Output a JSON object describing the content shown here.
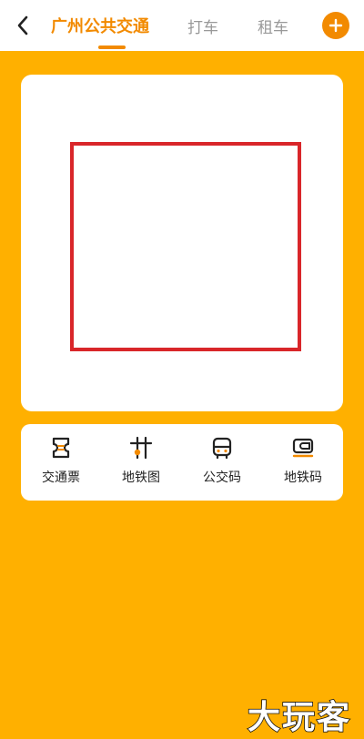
{
  "colors": {
    "background": "#FFB000",
    "accent": "#F28A00",
    "qr_frame": "#D9262A",
    "tab_inactive": "#999999"
  },
  "header": {
    "back_icon": "chevron-left-icon",
    "tabs": [
      {
        "label": "广州公共交通",
        "active": true
      },
      {
        "label": "打车",
        "active": false
      },
      {
        "label": "租车",
        "active": false
      }
    ],
    "add_icon": "plus-circle-icon"
  },
  "qr_card": {
    "code_icon": "qr-code-placeholder"
  },
  "actions": [
    {
      "label": "交通票",
      "icon": "ticket-icon"
    },
    {
      "label": "地铁图",
      "icon": "metro-map-icon"
    },
    {
      "label": "公交码",
      "icon": "bus-icon"
    },
    {
      "label": "地铁码",
      "icon": "metro-card-icon"
    }
  ],
  "watermark": {
    "text": "大玩客"
  }
}
